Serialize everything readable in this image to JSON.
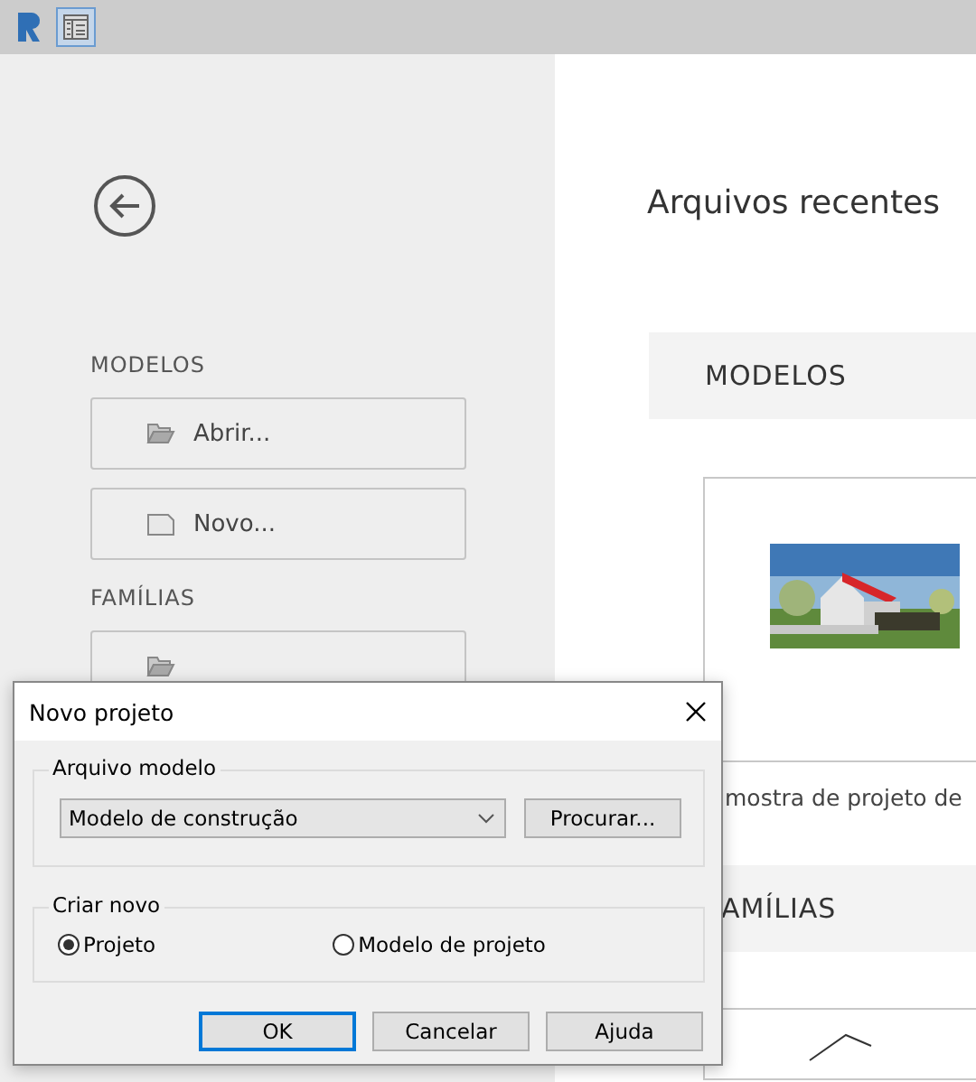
{
  "toolbar": {
    "items": [
      {
        "kind": "logo",
        "selected": false
      },
      {
        "kind": "panel",
        "selected": true
      }
    ]
  },
  "sidebar": {
    "sections": [
      {
        "title": "MODELOS",
        "buttons": [
          {
            "label": "Abrir...",
            "kind": "open"
          },
          {
            "label": "Novo...",
            "kind": "new"
          }
        ]
      },
      {
        "title": "FAMÍLIAS",
        "buttons": [
          {
            "kind": "open"
          }
        ]
      }
    ]
  },
  "main": {
    "title": "Arquivos recentes",
    "sections": [
      {
        "title": "MODELOS",
        "caption": "mostra de projeto de"
      },
      {
        "title": "AMÍLIAS"
      }
    ]
  },
  "dialog": {
    "title": "Novo projeto",
    "template_group": {
      "title": "Arquivo modelo",
      "value": "Modelo de construção",
      "browse": "Procurar..."
    },
    "create_group": {
      "title": "Criar novo",
      "options": [
        {
          "label": "Projeto",
          "selected": true
        },
        {
          "label": "Modelo de projeto",
          "selected": false
        }
      ]
    },
    "buttons": [
      {
        "label": "OK",
        "default": true
      },
      {
        "label": "Cancelar",
        "default": false
      },
      {
        "label": "Ajuda",
        "default": false
      }
    ]
  }
}
